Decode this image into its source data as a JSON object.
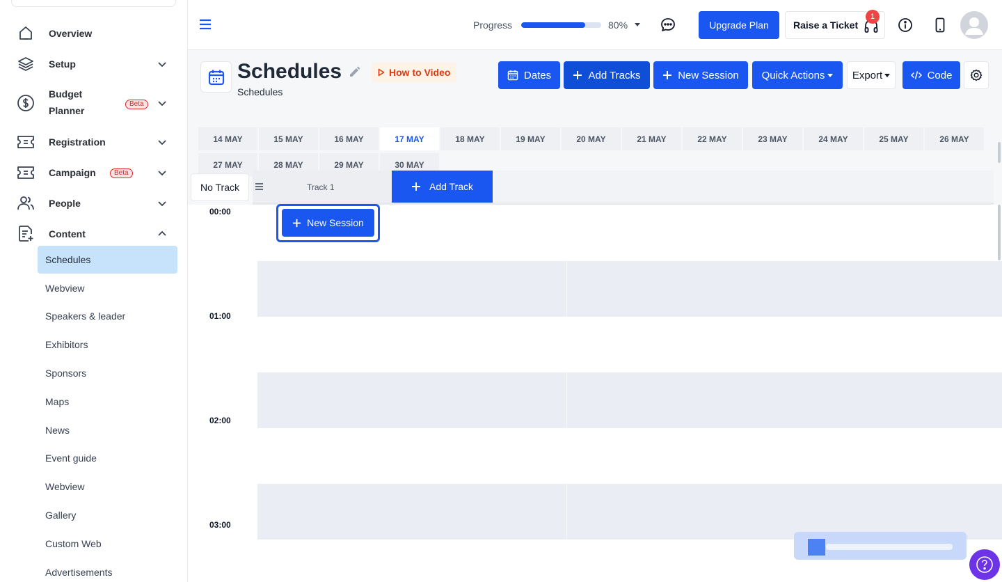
{
  "sidebar": {
    "items": [
      {
        "label": "Overview",
        "icon": "home-icon"
      },
      {
        "label": "Setup",
        "icon": "layers-icon"
      },
      {
        "label": "Budget",
        "label2": "Planner",
        "badge": "Beta",
        "icon": "dollar-icon"
      },
      {
        "label": "Registration",
        "icon": "ticket-icon"
      },
      {
        "label": "Campaign",
        "badge": "Beta",
        "icon": "campaign-icon"
      },
      {
        "label": "People",
        "icon": "people-icon"
      },
      {
        "label": "Content",
        "icon": "content-icon"
      }
    ],
    "sub_items": [
      "Schedules",
      "Webview",
      "Speakers & leader",
      "Exhibitors",
      "Sponsors",
      "Maps",
      "News",
      "Event guide",
      "Webview",
      "Gallery",
      "Custom Web",
      "Advertisements"
    ]
  },
  "header": {
    "progress_label": "Progress",
    "progress_value": 80,
    "progress_text": "80%",
    "upgrade_label": "Upgrade Plan",
    "ticket_label": "Raise a Ticket",
    "ticket_badge": "1"
  },
  "page": {
    "title": "Schedules",
    "subtitle": "Schedules",
    "how_to": "How to Video"
  },
  "toolbar": {
    "dates": "Dates",
    "add_tracks": "Add Tracks",
    "new_session": "New Session",
    "quick_actions": "Quick Actions",
    "export": "Export",
    "code": "Code"
  },
  "dates": [
    "14 MAY",
    "15 MAY",
    "16 MAY",
    "17 MAY",
    "18 MAY",
    "19 MAY",
    "20 MAY",
    "21 MAY",
    "22 MAY",
    "23 MAY",
    "24 MAY",
    "25 MAY",
    "26 MAY",
    "27 MAY",
    "28 MAY",
    "29 MAY",
    "30 MAY"
  ],
  "active_date": "17 MAY",
  "tracks": {
    "no_track": "No Track",
    "track1": "Track 1",
    "add_track": "Add Track"
  },
  "grid": {
    "times": [
      "00:00",
      "01:00",
      "02:00",
      "03:00"
    ],
    "new_session": "New Session"
  },
  "colors": {
    "primary": "#1a56f0",
    "active_sidebar": "#c7e2fb",
    "help": "#6d33e6"
  }
}
